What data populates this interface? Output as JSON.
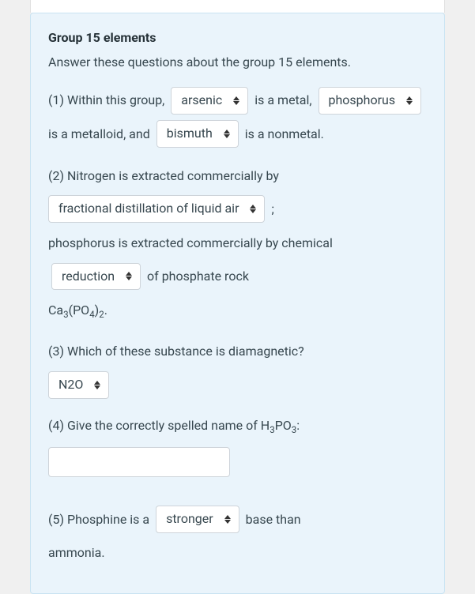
{
  "title": "Group 15 elements",
  "intro": "Answer these questions about the group 15 elements.",
  "q1": {
    "pre": "(1) Within this group,",
    "sel_metal": "arsenic",
    "mid1": "is a",
    "mid2": "metal,",
    "sel_metalloid": "phosphorus",
    "mid3": "is a metalloid, and",
    "sel_nonmetal": "bismuth",
    "post": "is a nonmetal."
  },
  "q2": {
    "line1": "(2) Nitrogen is extracted commercially by",
    "sel_method": "fractional distillation of liquid air",
    "semicolon": ";",
    "line2a": "phosphorus is extracted commercially by",
    "line2b": "chemical",
    "sel_process": "reduction",
    "line2c": "of phosphate rock",
    "formula_ca": "Ca",
    "formula_3": "3",
    "formula_po": "(PO",
    "formula_4": "4",
    "formula_close": ")",
    "formula_2": "2",
    "formula_dot": "."
  },
  "q3": {
    "text": "(3) Which of these substance is diamagnetic?",
    "sel": "N2O"
  },
  "q4": {
    "pre": "(4) Give the correctly spelled name of H",
    "sub3": "3",
    "mid": "PO",
    "sub3b": "3",
    "post": ":",
    "value": ""
  },
  "q5": {
    "pre": "(5) Phosphine is a",
    "sel": "stronger",
    "post1": "base than",
    "post2": "ammonia."
  }
}
